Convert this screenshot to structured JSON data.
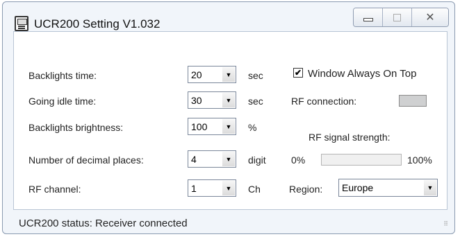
{
  "window": {
    "title": "UCR200  Setting  V1.032",
    "controls": {
      "minimize": "▭",
      "maximize": "☐",
      "close": "✕"
    }
  },
  "settings": [
    {
      "label": "Backlights time:",
      "value": "20",
      "unit": "sec"
    },
    {
      "label": "Going idle time:",
      "value": "30",
      "unit": "sec"
    },
    {
      "label": "Backlights brightness:",
      "value": "100",
      "unit": "%"
    },
    {
      "label": "Number of decimal places:",
      "value": "4",
      "unit": "digit"
    },
    {
      "label": "RF channel:",
      "value": "1",
      "unit": "Ch"
    }
  ],
  "options": {
    "always_on_top_label": "Window Always On Top",
    "always_on_top_checked": true,
    "check_mark": "✔",
    "rf_connection_label": "RF connection:",
    "rf_signal_label": "RF signal strength:",
    "signal_min": "0%",
    "signal_max": "100%",
    "signal_value": 0,
    "region_label": "Region:",
    "region_value": "Europe"
  },
  "status": {
    "text": "UCR200 status: Receiver connected"
  },
  "icons": {
    "dropdown_arrow": "▼",
    "resize_grip": "⠿"
  },
  "colors": {
    "rf_connection_indicator": "#cfd0d1"
  }
}
